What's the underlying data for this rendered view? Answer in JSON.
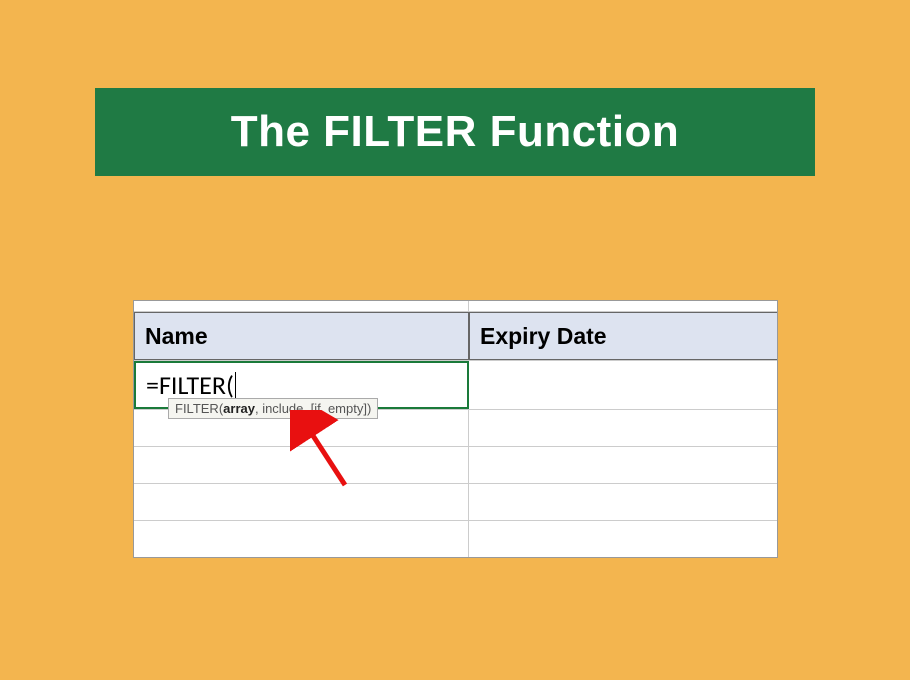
{
  "title": "The FILTER Function",
  "spreadsheet": {
    "headers": {
      "col_a": "Name",
      "col_b": "Expiry Date"
    },
    "formula_cell": "=FILTER(",
    "tooltip": {
      "prefix": "FILTER(",
      "arg_bold": "array",
      "suffix": ", include, [if_empty])"
    }
  }
}
